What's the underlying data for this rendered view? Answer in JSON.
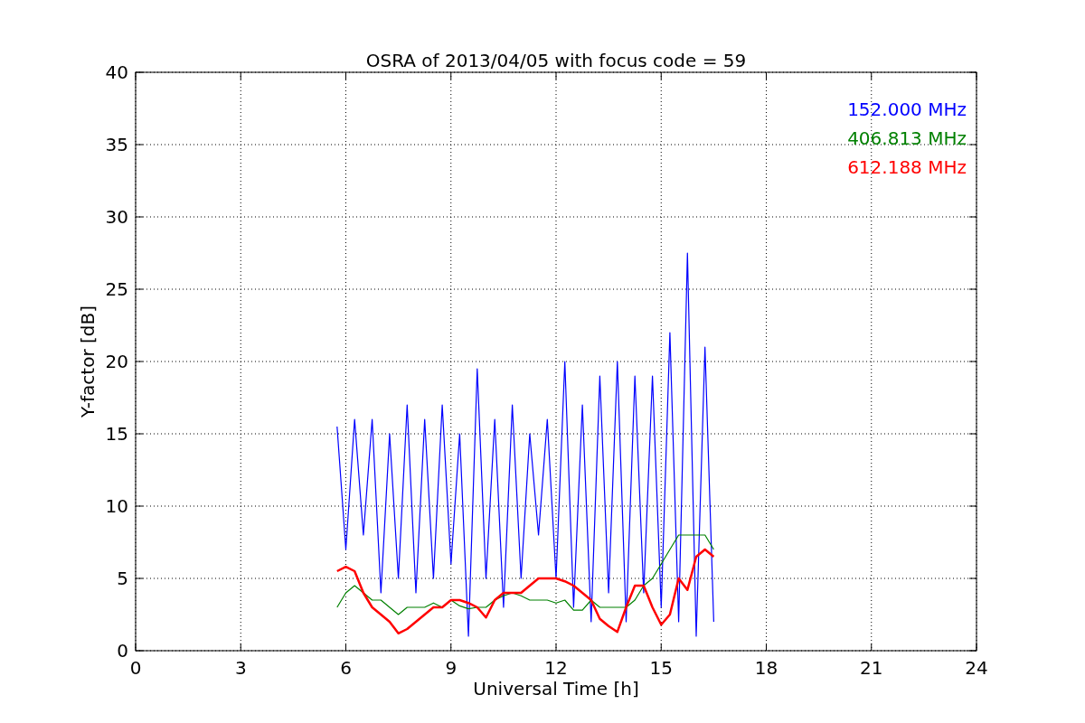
{
  "figure": {
    "chart_data": {
      "type": "line",
      "title": "OSRA of 2013/04/05 with focus code = 59",
      "xlabel": "Universal Time [h]",
      "ylabel": "Y-factor [dB]",
      "x": [
        5.75,
        6,
        6.25,
        6.5,
        6.75,
        7,
        7.25,
        7.5,
        7.75,
        8,
        8.25,
        8.5,
        8.75,
        9,
        9.25,
        9.5,
        9.75,
        10,
        10.25,
        10.5,
        10.75,
        11,
        11.25,
        11.5,
        11.75,
        12,
        12.25,
        12.5,
        12.75,
        13,
        13.25,
        13.5,
        13.75,
        14,
        14.25,
        14.5,
        14.75,
        15,
        15.25,
        15.5,
        15.75,
        16,
        16.25,
        16.5
      ],
      "series": [
        {
          "name": "152.000 MHz",
          "color": "#0000ff",
          "values": [
            15.5,
            7,
            16,
            8,
            16,
            4,
            15,
            5,
            17,
            4,
            16,
            5,
            17,
            6,
            15,
            1,
            19.5,
            5,
            16,
            3,
            17,
            5,
            15,
            8,
            16,
            5,
            20,
            3,
            17,
            2,
            19,
            4,
            20,
            2,
            19,
            4,
            19,
            3,
            22,
            2,
            27.5,
            1,
            21,
            2
          ]
        },
        {
          "name": "406.813 MHz",
          "color": "#008000",
          "values": [
            3,
            4,
            4.5,
            4,
            3.5,
            3.5,
            3,
            2.5,
            3,
            3,
            3,
            3.3,
            3,
            3.5,
            3.1,
            2.9,
            3,
            3,
            3.5,
            3.8,
            4,
            3.8,
            3.5,
            3.5,
            3.5,
            3.3,
            3.5,
            2.8,
            2.8,
            3.5,
            3,
            3,
            3,
            3,
            3.5,
            4.5,
            5,
            6,
            7,
            8,
            8,
            8,
            8,
            7
          ]
        },
        {
          "name": "612.188 MHz",
          "color": "#ff0000",
          "values": [
            5.5,
            5.8,
            5.5,
            4,
            3,
            2.5,
            2,
            1.2,
            1.5,
            2,
            2.5,
            3,
            3,
            3.5,
            3.5,
            3.3,
            3,
            2.3,
            3.5,
            4,
            4,
            4,
            4.5,
            5,
            5,
            5,
            4.8,
            4.5,
            4,
            3.5,
            2.2,
            1.7,
            1.3,
            3,
            4.5,
            4.5,
            3,
            1.8,
            2.5,
            5,
            4.2,
            6.5,
            7,
            6.5
          ]
        }
      ],
      "xlim": [
        0,
        24
      ],
      "ylim": [
        0,
        40
      ],
      "xticks": [
        0,
        3,
        6,
        9,
        12,
        15,
        18,
        21,
        24
      ],
      "yticks": [
        0,
        5,
        10,
        15,
        20,
        25,
        30,
        35,
        40
      ],
      "grid": true
    }
  }
}
